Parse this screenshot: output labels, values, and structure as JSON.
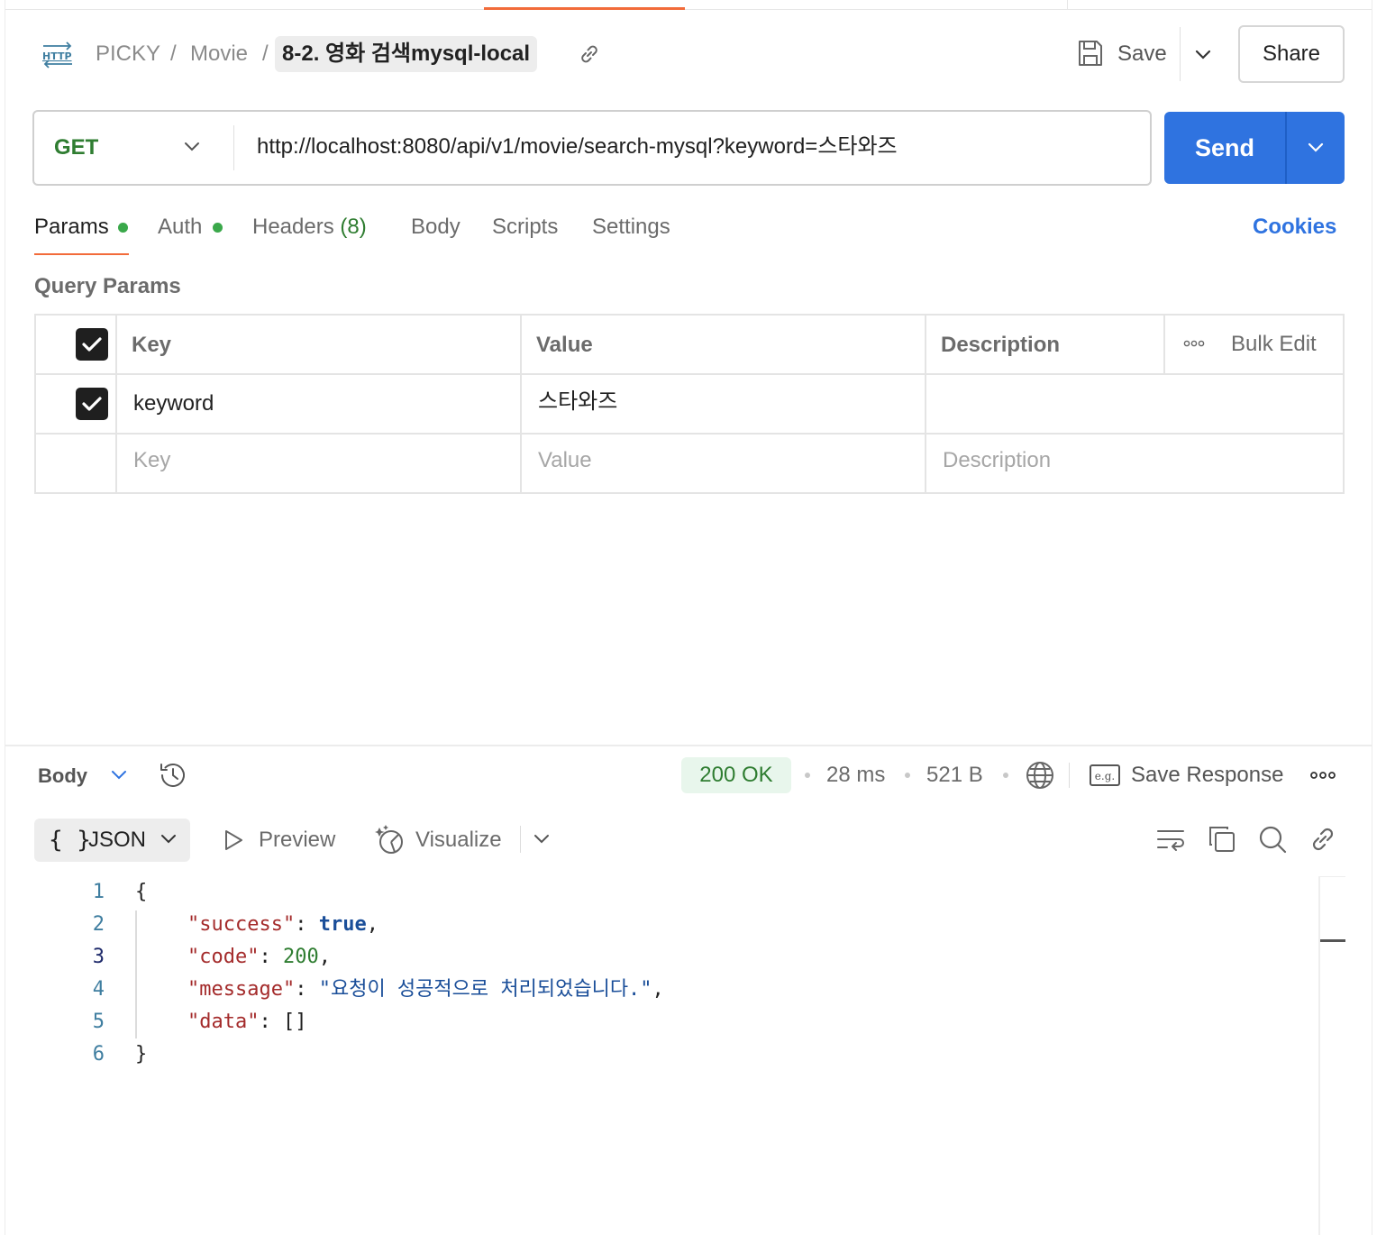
{
  "header": {
    "breadcrumb": [
      "PICKY",
      "Movie"
    ],
    "separator": "/",
    "current_request": "8-2. 영화 검색mysql-local",
    "save_label": "Save",
    "share_label": "Share"
  },
  "request": {
    "method": "GET",
    "url": "http://localhost:8080/api/v1/movie/search-mysql?keyword=스타와즈",
    "send_label": "Send"
  },
  "tabs": {
    "params": "Params",
    "auth": "Auth",
    "headers": "Headers",
    "headers_count": "(8)",
    "body": "Body",
    "scripts": "Scripts",
    "settings": "Settings",
    "cookies": "Cookies"
  },
  "query_params": {
    "title": "Query Params",
    "columns": {
      "key": "Key",
      "value": "Value",
      "description": "Description"
    },
    "bulk_edit": "Bulk Edit",
    "rows": [
      {
        "enabled": true,
        "key": "keyword",
        "value": "스타와즈",
        "description": ""
      }
    ],
    "placeholder": {
      "key": "Key",
      "value": "Value",
      "description": "Description"
    }
  },
  "response": {
    "body_label": "Body",
    "status": "200 OK",
    "time": "28 ms",
    "size": "521 B",
    "save_response": "Save Response",
    "format": "JSON",
    "format_braces": "{ }",
    "preview": "Preview",
    "visualize": "Visualize",
    "eg_badge": "e.g.",
    "line_numbers": [
      "1",
      "2",
      "3",
      "4",
      "5",
      "6"
    ],
    "json": {
      "open": "{",
      "close": "}",
      "success_key": "\"success\"",
      "success_val": "true",
      "code_key": "\"code\"",
      "code_val": "200",
      "message_key": "\"message\"",
      "message_val": "\"요청이 성공적으로 처리되었습니다.\"",
      "data_key": "\"data\"",
      "data_val": "[]",
      "colon": ": ",
      "comma": ","
    }
  },
  "colors": {
    "accent_orange": "#f26b3a",
    "send_blue": "#2f73e0",
    "method_green": "#2f7d31",
    "status_bg": "#e8f6ec"
  }
}
